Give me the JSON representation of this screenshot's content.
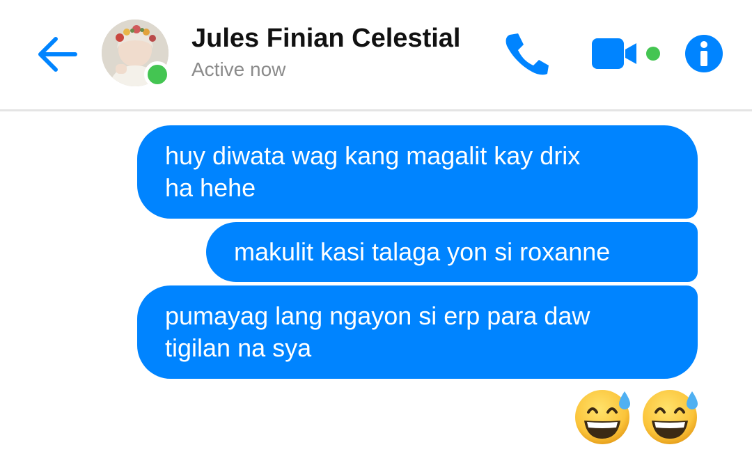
{
  "header": {
    "contact_name": "Jules Finian Celestial",
    "status": "Active now",
    "back_icon": "arrow-left-icon",
    "call_icon": "phone-icon",
    "video_icon": "video-camera-icon",
    "info_icon": "info-icon"
  },
  "colors": {
    "accent": "#0084ff",
    "online": "#44c552",
    "bubble_text": "#ffffff",
    "status_text": "#8b8b8b",
    "name_text": "#111111"
  },
  "messages": [
    {
      "lines": [
        "huy diwata wag kang magalit kay drix",
        "ha hehe"
      ]
    },
    {
      "lines": [
        "makulit kasi talaga yon si roxanne"
      ]
    },
    {
      "lines": [
        "pumayag lang ngayon si erp para daw",
        "tigilan na sya"
      ]
    }
  ],
  "emoji_message": {
    "emoji": [
      "grinning-face-with-sweat",
      "grinning-face-with-sweat"
    ]
  }
}
